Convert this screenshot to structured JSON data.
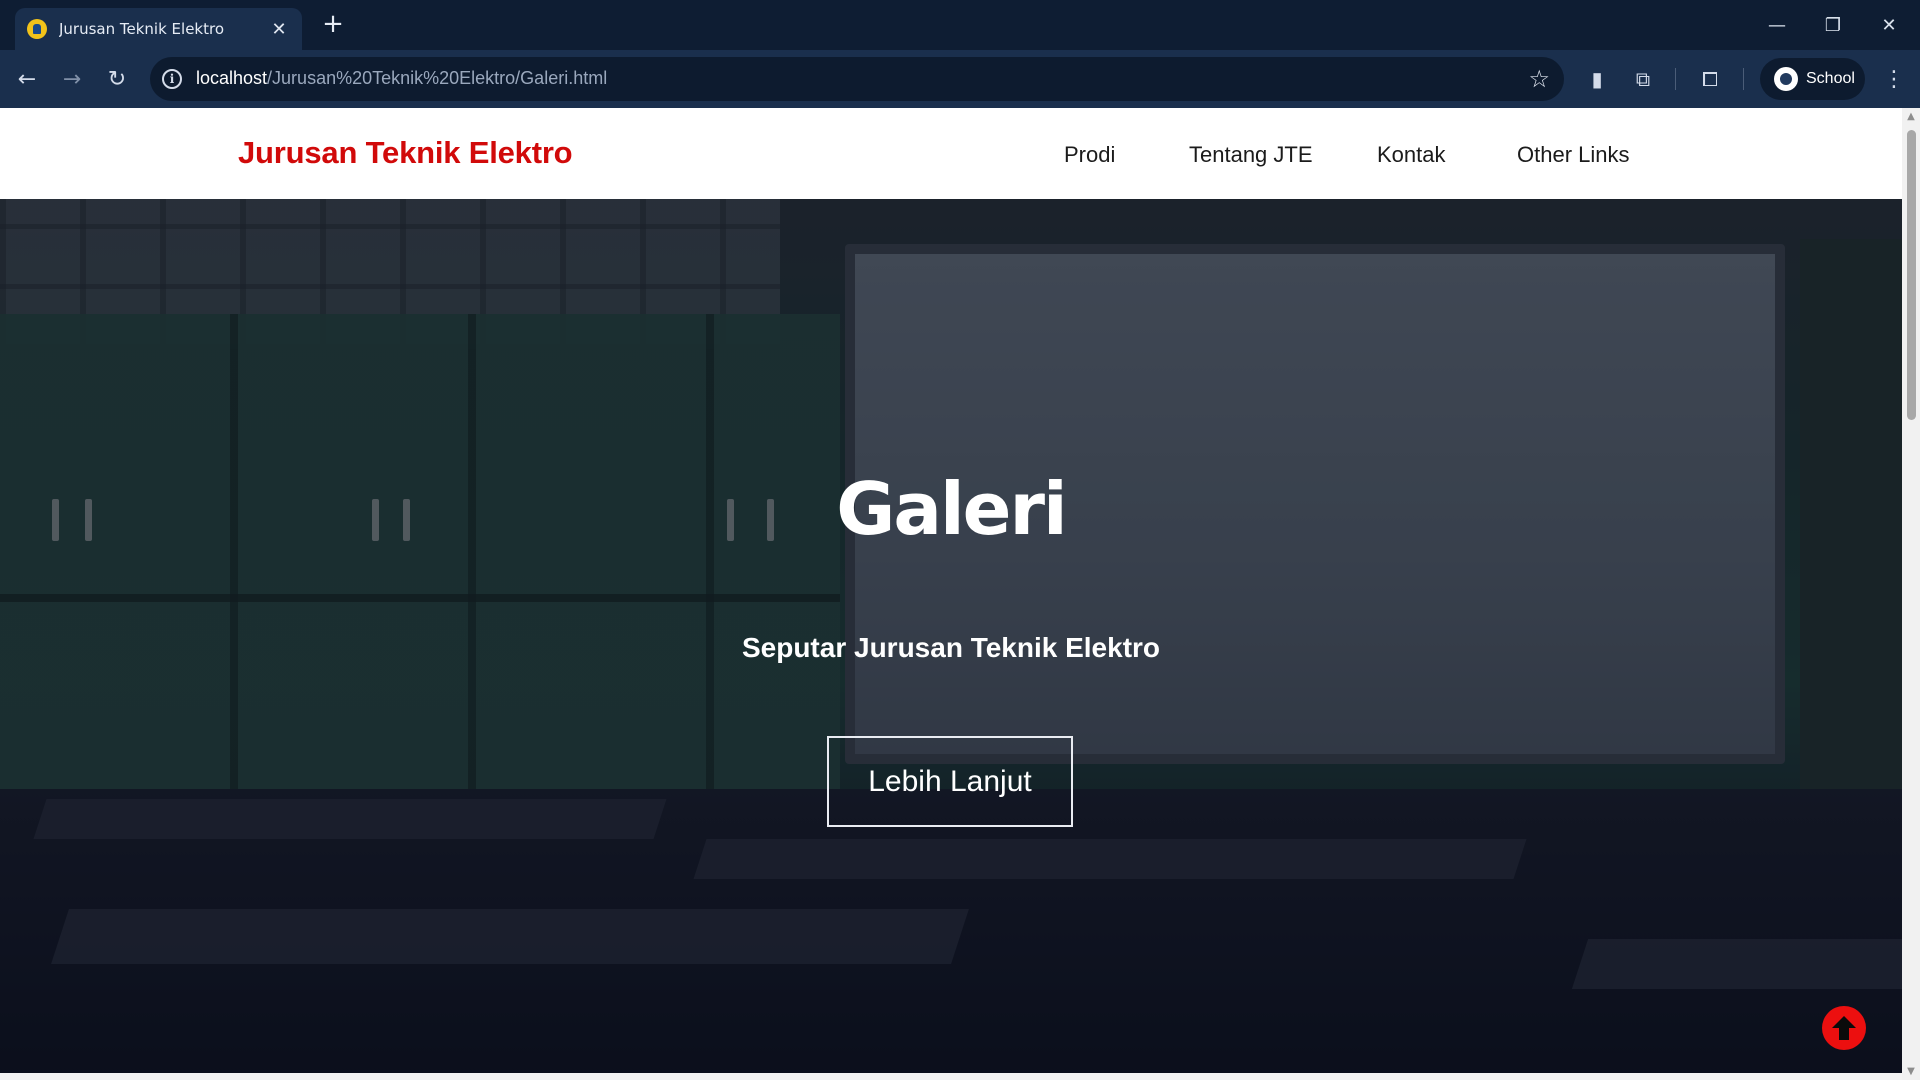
{
  "browser": {
    "tab_title": "Jurusan Teknik Elektro",
    "url_host": "localhost",
    "url_path": "/Jurusan%20Teknik%20Elektro/Galeri.html",
    "profile_label": "School"
  },
  "site": {
    "brand": "Jurusan Teknik Elektro",
    "brand_color": "#d10a0a",
    "nav": [
      "Prodi",
      "Tentang JTE",
      "Kontak",
      "Other Links"
    ]
  },
  "hero": {
    "title": "Galeri",
    "subtitle": "Seputar Jurusan Teknik Elektro",
    "button_label": "Lebih Lanjut"
  },
  "back_to_top_color": "#ec0f0f"
}
